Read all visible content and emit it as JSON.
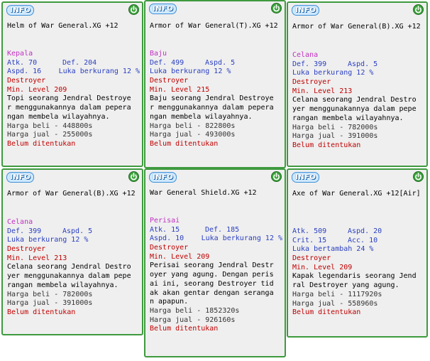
{
  "badge_label": "INFO",
  "cards": [
    {
      "title": "Helm of War General.XG +12",
      "type": "Kepala",
      "stat1": [
        "Atk. 70",
        "Def. 204"
      ],
      "stat2": [
        "Aspd. 16",
        "Luka berkurang 12 %"
      ],
      "stat3": "",
      "job": "Destroyer",
      "level": "Min. Level 209",
      "desc": [
        "Topi seorang Jendral Destroye",
        "r menggunakannya dalam pepera",
        "ngan membela wilayahnya."
      ],
      "buy": "Harga beli - 448800s",
      "sell": "Harga jual - 255000s",
      "status": "Belum ditentukan"
    },
    {
      "title": "Armor of War General(T).XG +12",
      "type": "Baju",
      "stat1": [
        "Def. 499",
        "Aspd. 5"
      ],
      "stat2": [
        "Luka berkurang 12 %",
        ""
      ],
      "stat3": "",
      "job": "Destroyer",
      "level": "Min. Level 215",
      "desc": [
        "Baju seorang Jendral Destroye",
        "r menggunakannya dalam pepera",
        "ngan membela wilayahnya."
      ],
      "buy": "Harga beli - 822800s",
      "sell": "Harga jual - 493000s",
      "status": "Belum ditentukan"
    },
    {
      "title": "Armor of War General(B).XG +12",
      "type": "Celana",
      "stat1": [
        "Def. 399",
        "Aspd. 5"
      ],
      "stat2": [
        "Luka berkurang 12 %",
        ""
      ],
      "stat3": "",
      "job": "Destroyer",
      "level": "Min. Level 213",
      "desc": [
        "Celana seorang Jendral Destro",
        "yer menggunakannya dalam pepe",
        "rangan membela wilayahnya."
      ],
      "buy": "Harga beli - 782000s",
      "sell": "Harga jual - 391000s",
      "status": "Belum ditentukan"
    },
    {
      "title": "Armor of War General(B).XG +12",
      "type": "Celana",
      "stat1": [
        "Def. 399",
        "Aspd. 5"
      ],
      "stat2": [
        "Luka berkurang 12 %",
        ""
      ],
      "stat3": "",
      "job": "Destroyer",
      "level": "Min. Level 213",
      "desc": [
        "Celana seorang Jendral Destro",
        "yer menggunakannya dalam pepe",
        "rangan membela wilayahnya."
      ],
      "buy": "Harga beli - 782000s",
      "sell": "Harga jual - 391000s",
      "status": "Belum ditentukan"
    },
    {
      "title": "War General Shield.XG +12",
      "type": "Perisai",
      "stat1": [
        "Atk. 15",
        "Def. 185"
      ],
      "stat2": [
        "Aspd. 10",
        "Luka berkurang 12 %"
      ],
      "stat3": "",
      "job": "Destroyer",
      "level": "Min. Level 209",
      "desc": [
        "Perisai seorang Jendral Destr",
        "oyer yang agung. Dengan peris",
        "ai ini, seorang Destroyer tid",
        "ak akan gentar dengan serangа",
        "n apapun."
      ],
      "buy": "Harga beli - 1852320s",
      "sell": "Harga jual - 926160s",
      "status": "Belum ditentukan"
    },
    {
      "title": "Axe of War General.XG +12[Air]",
      "type": "",
      "stat1": [
        "Atk. 509",
        "Aspd. 20"
      ],
      "stat2": [
        "Crit. 15",
        "Acc. 10"
      ],
      "stat3": "Luka bertambah 24 %",
      "job": "Destroyer",
      "level": "Min. Level 209",
      "desc": [
        "Kapak legendaris seorang Jend",
        "ral Destroyer yang agung."
      ],
      "buy": "Harga beli - 1117920s",
      "sell": "Harga jual - 558960s",
      "status": "Belum ditentukan"
    }
  ]
}
